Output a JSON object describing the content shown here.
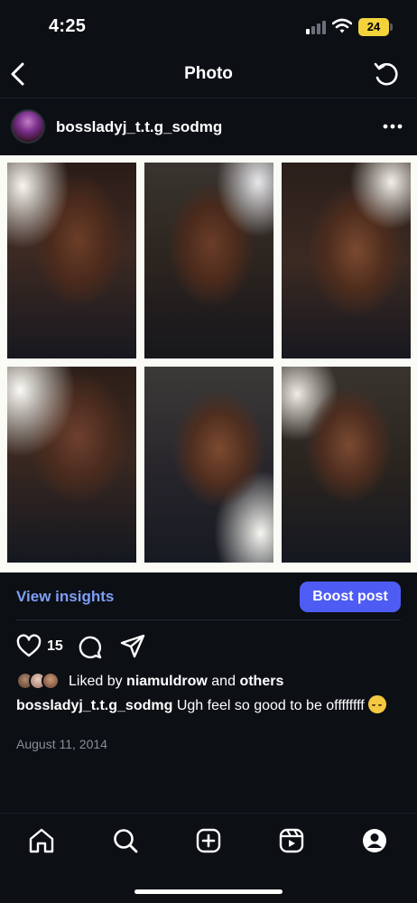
{
  "status": {
    "time": "4:25",
    "battery": "24"
  },
  "nav": {
    "title": "Photo"
  },
  "post": {
    "username": "bossladyj_t.t.g_sodmg",
    "likes_count": "15",
    "liked_by_prefix": "Liked by",
    "liked_by_user": "niamuldrow",
    "liked_by_and": "and",
    "liked_by_others": "others",
    "caption_text": "Ugh feel so good to be offffffff",
    "date": "August 11, 2014"
  },
  "insights": {
    "view_label": "View insights",
    "boost_label": "Boost post"
  },
  "colors": {
    "background": "#0c0f14",
    "link": "#7f9ef6",
    "boost_button": "#4e5cf4",
    "battery": "#f4d23c"
  },
  "icons": {
    "nav": [
      "back-arrow-icon",
      "refresh-icon",
      "more-icon"
    ],
    "actions": [
      "heart-icon",
      "comment-icon",
      "share-icon"
    ],
    "tabs": [
      "home-icon",
      "search-icon",
      "create-icon",
      "reels-icon",
      "profile-icon"
    ],
    "caption_emoji": "relieved-face-emoji"
  }
}
